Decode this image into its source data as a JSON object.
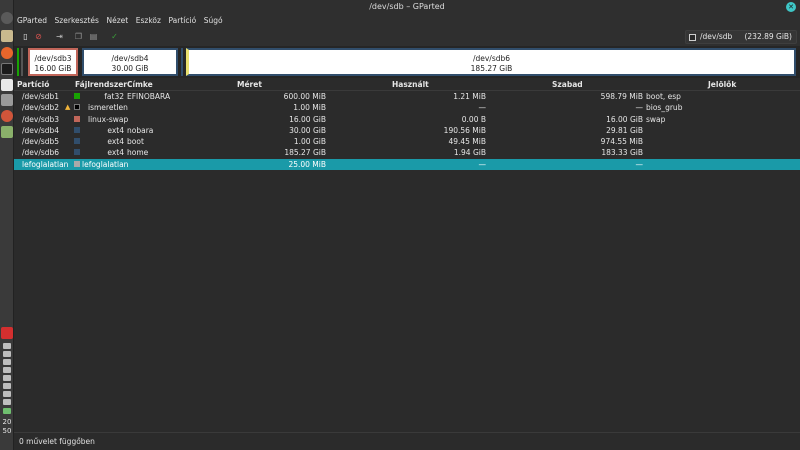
{
  "window": {
    "title": "/dev/sdb – GParted"
  },
  "menu": [
    "GParted",
    "Szerkesztés",
    "Nézet",
    "Eszköz",
    "Partíció",
    "Súgó"
  ],
  "device": {
    "name": "/dev/sdb",
    "size": "(232.89 GiB)"
  },
  "graphic": [
    {
      "name": "/dev/sdb3",
      "size": "16.00 GiB"
    },
    {
      "name": "/dev/sdb4",
      "size": "30.00 GiB"
    },
    {
      "name": "/dev/sdb6",
      "size": "185.27 GiB"
    }
  ],
  "columns": [
    "Partíció",
    "Fájlrendszer",
    "Címke",
    "Méret",
    "Használt",
    "Szabad",
    "Jelölők"
  ],
  "rows": [
    {
      "partition": "/dev/sdb1",
      "fs": "fat32",
      "label": "EFINOBARA",
      "size": "600.00 MiB",
      "used": "1.21 MiB",
      "free": "598.79 MiB",
      "flags": "boot, esp",
      "color": "#18a303"
    },
    {
      "partition": "/dev/sdb2",
      "fs": "ismeretlen",
      "label": "",
      "size": "1.00 MiB",
      "used": "—",
      "free": "—",
      "flags": "bios_grub",
      "color": "#000000",
      "warn": true
    },
    {
      "partition": "/dev/sdb3",
      "fs": "linux-swap",
      "label": "",
      "size": "16.00 GiB",
      "used": "0.00 B",
      "free": "16.00 GiB",
      "flags": "swap",
      "color": "#c1665a"
    },
    {
      "partition": "/dev/sdb4",
      "fs": "ext4",
      "label": "nobara",
      "size": "30.00 GiB",
      "used": "190.56 MiB",
      "free": "29.81 GiB",
      "flags": "",
      "color": "#314e6c"
    },
    {
      "partition": "/dev/sdb5",
      "fs": "ext4",
      "label": "boot",
      "size": "1.00 GiB",
      "used": "49.45 MiB",
      "free": "974.55 MiB",
      "flags": "",
      "color": "#314e6c"
    },
    {
      "partition": "/dev/sdb6",
      "fs": "ext4",
      "label": "home",
      "size": "185.27 GiB",
      "used": "1.94 GiB",
      "free": "183.33 GiB",
      "flags": "",
      "color": "#314e6c"
    },
    {
      "partition": "lefoglalatlan",
      "fs": "lefoglalatlan",
      "label": "",
      "size": "25.00 MiB",
      "used": "—",
      "free": "—",
      "flags": "",
      "color": "#a9a9a9",
      "selected": true
    }
  ],
  "status": "0 művelet függőben",
  "clock": {
    "hour": "20",
    "minute": "50"
  },
  "icons": {
    "toolbar": [
      "new-partition-icon",
      "delete-icon",
      "resize-move-icon",
      "copy-icon",
      "paste-icon",
      "apply-icon"
    ]
  },
  "colors": {
    "selection": "#1a9aa8",
    "accent_close": "#3ec6c6",
    "apply": "#3aa03a"
  }
}
